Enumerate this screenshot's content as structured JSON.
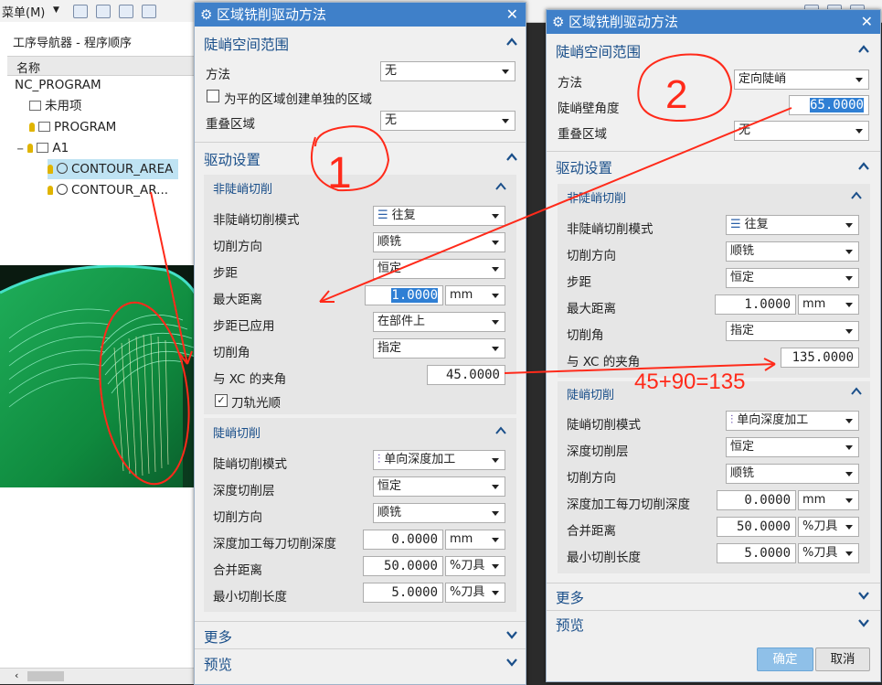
{
  "menubar": {
    "menu_label": "菜单(M)"
  },
  "navigator": {
    "title": "工序导航器 - 程序顺序",
    "column_header": "名称",
    "rows": [
      "NC_PROGRAM",
      "未用项",
      "PROGRAM",
      "A1",
      "CONTOUR_AREA",
      "CONTOUR_AR..."
    ],
    "selected": "CONTOUR_AREA"
  },
  "dialog1": {
    "title": "区域铣削驱动方法",
    "steep_section": "陡峭空间范围",
    "method_label": "方法",
    "method_value": "无",
    "flat_region_label": "为平的区域创建单独的区域",
    "overlap_label": "重叠区域",
    "overlap_value": "无",
    "drive_section": "驱动设置",
    "nonsteep_sub": "非陡峭切削",
    "nonsteep_mode_label": "非陡峭切削模式",
    "nonsteep_mode_value": "往复",
    "cut_direction_label": "切削方向",
    "cut_direction_value": "顺铣",
    "stepover_label": "步距",
    "stepover_value": "恒定",
    "max_distance_label": "最大距离",
    "max_distance_value": "1.0000",
    "max_distance_unit": "mm",
    "stepover_applied_label": "步距已应用",
    "stepover_applied_value": "在部件上",
    "cut_angle_label": "切削角",
    "cut_angle_value": "指定",
    "xc_angle_label": "与 XC 的夹角",
    "xc_angle_value": "45.0000",
    "smooth_label": "刀轨光顺",
    "steep_sub": "陡峭切削",
    "steep_mode_label": "陡峭切削模式",
    "steep_mode_value": "单向深度加工",
    "depth_layer_label": "深度切削层",
    "depth_layer_value": "恒定",
    "steep_cut_direction_label": "切削方向",
    "steep_cut_direction_value": "顺铣",
    "depth_per_cut_label": "深度加工每刀切削深度",
    "depth_per_cut_value": "0.0000",
    "depth_per_cut_unit": "mm",
    "merge_distance_label": "合并距离",
    "merge_distance_value": "50.0000",
    "merge_distance_unit": "%刀具",
    "min_cut_length_label": "最小切削长度",
    "min_cut_length_value": "5.0000",
    "min_cut_length_unit": "%刀具",
    "more_section": "更多",
    "preview_section": "预览"
  },
  "dialog2": {
    "title": "区域铣削驱动方法",
    "steep_section": "陡峭空间范围",
    "method_label": "方法",
    "method_value": "定向陡峭",
    "steep_angle_label": "陡峭壁角度",
    "steep_angle_value": "65.0000",
    "overlap_label": "重叠区域",
    "overlap_value": "无",
    "drive_section": "驱动设置",
    "nonsteep_sub": "非陡峭切削",
    "nonsteep_mode_label": "非陡峭切削模式",
    "nonsteep_mode_value": "往复",
    "cut_direction_label": "切削方向",
    "cut_direction_value": "顺铣",
    "stepover_label": "步距",
    "stepover_value": "恒定",
    "max_distance_label": "最大距离",
    "max_distance_value": "1.0000",
    "max_distance_unit": "mm",
    "cut_angle_label": "切削角",
    "cut_angle_value": "指定",
    "xc_angle_label": "与 XC 的夹角",
    "xc_angle_value": "135.0000",
    "steep_sub": "陡峭切削",
    "steep_mode_label": "陡峭切削模式",
    "steep_mode_value": "单向深度加工",
    "depth_layer_label": "深度切削层",
    "depth_layer_value": "恒定",
    "steep_cut_direction_label": "切削方向",
    "steep_cut_direction_value": "顺铣",
    "depth_per_cut_label": "深度加工每刀切削深度",
    "depth_per_cut_value": "0.0000",
    "depth_per_cut_unit": "mm",
    "merge_distance_label": "合并距离",
    "merge_distance_value": "50.0000",
    "merge_distance_unit": "%刀具",
    "min_cut_length_label": "最小切削长度",
    "min_cut_length_value": "5.0000",
    "min_cut_length_unit": "%刀具",
    "more_section": "更多",
    "preview_section": "预览",
    "ok_label": "确定",
    "cancel_label": "取消"
  },
  "annotations": {
    "mark1": "1",
    "mark2": "2",
    "formula": "45+90=135"
  },
  "colors": {
    "title_bar": "#3f80c9",
    "section_text": "#1a4f8a",
    "annotation": "#ff2a1a",
    "selection": "#2f7fd4"
  }
}
